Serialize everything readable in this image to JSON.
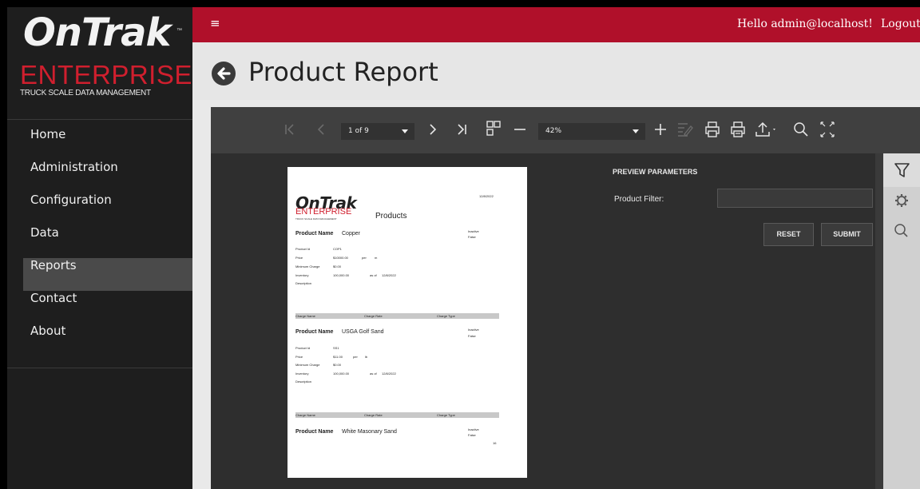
{
  "logo": {
    "brand": "OnTrak",
    "tm": "™",
    "edition": "ENTERPRISE",
    "tagline": "TRUCK SCALE DATA MANAGEMENT"
  },
  "nav": {
    "items": [
      {
        "label": "Home"
      },
      {
        "label": "Administration"
      },
      {
        "label": "Configuration"
      },
      {
        "label": "Data"
      },
      {
        "label": "Reports",
        "active": true
      },
      {
        "label": "Contact"
      },
      {
        "label": "About"
      }
    ]
  },
  "topbar": {
    "menu_icon": "≡",
    "greeting": "Hello admin@localhost!",
    "logout": "Logout"
  },
  "page": {
    "title": "Product Report"
  },
  "viewer": {
    "page_indicator": "1 of 9",
    "zoom": "42%",
    "params_title": "PREVIEW PARAMETERS",
    "filter_label": "Product Filter:",
    "filter_value": "",
    "reset_label": "RESET",
    "submit_label": "SUBMIT"
  },
  "report": {
    "date": "12/8/2022",
    "logo_brand": "OnTrak",
    "logo_edition": "ENTERPRISE",
    "logo_tagline": "TRUCK SCALE DATA MANAGEMENT",
    "heading": "Products",
    "product_name_label": "Product Name",
    "inactive_label": "Inactive",
    "field_labels": [
      "Product Id",
      "Price",
      "Minimum Charge",
      "Inventory",
      "Description"
    ],
    "per_label": "per",
    "as_of_label": "as of",
    "charge_headers": [
      "Charge Name",
      "Charge Rate",
      "Charge Type"
    ],
    "products": [
      {
        "name": "Copper",
        "inactive": "False",
        "id": "COP1",
        "price": "$10000.00",
        "unit": "m",
        "min_charge": "$0.00",
        "inventory": "100,000.00",
        "as_of": "12/8/2022"
      },
      {
        "name": "USGA Golf Sand",
        "inactive": "False",
        "id": "SS1",
        "price": "$11.00",
        "unit": "lb",
        "min_charge": "$0.00",
        "inventory": "100,000.00",
        "as_of": "12/8/2022"
      },
      {
        "name": "White Masonary Sand",
        "inactive": "False",
        "trailing": "16"
      }
    ]
  },
  "colors": {
    "brand_red": "#b0102a",
    "logo_red": "#d01f2e",
    "sidebar": "#1e1e1e",
    "viewer_dark": "#2e2e2e"
  }
}
